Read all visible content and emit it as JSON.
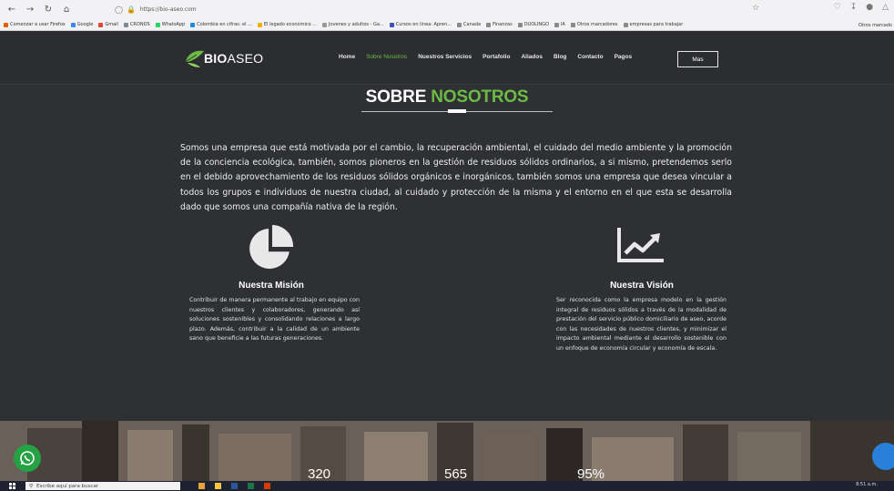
{
  "browser": {
    "url": "https://bio-aseo.com",
    "bookmarks": [
      {
        "label": "Comenzar a usar Firefox",
        "color": "#e66000"
      },
      {
        "label": "Google",
        "color": "#4285f4"
      },
      {
        "label": "Gmail",
        "color": "#ea4335"
      },
      {
        "label": "CRONOS",
        "color": "#7b8a99"
      },
      {
        "label": "WhatsApp",
        "color": "#25d366"
      },
      {
        "label": "Colombia en cifras: el ...",
        "color": "#1e88e5"
      },
      {
        "label": "El legado económico ...",
        "color": "#f2b200"
      },
      {
        "label": "Jovenes y adultos - Ga...",
        "color": "#999999"
      },
      {
        "label": "Cursos en línea: Apren...",
        "color": "#3f51b5"
      },
      {
        "label": "Canada",
        "color": "#8a8a8a"
      },
      {
        "label": "Finanzas",
        "color": "#8a8a8a"
      },
      {
        "label": "DUOLINGO",
        "color": "#8a8a8a"
      },
      {
        "label": "IA",
        "color": "#8a8a8a"
      },
      {
        "label": "Otros marcadores",
        "color": "#8a8a8a"
      },
      {
        "label": "empresas para trabajar",
        "color": "#8a8a8a"
      }
    ],
    "other_bookmarks": "Otros marcado"
  },
  "site": {
    "logo_bio": "BIO",
    "logo_aseo": "ASEO",
    "nav": [
      "Home",
      "Sobre Nosotros",
      "Nuestros Servicios",
      "Portafolio",
      "Aliados",
      "Blog",
      "Contacto",
      "Pagos"
    ],
    "nav_active": "Sobre Nosotros",
    "nav_more": "Mas",
    "accent": "#6dbb45"
  },
  "about": {
    "title_white": "SOBRE",
    "title_green": "NOSOTROS",
    "intro": "Somos una empresa que está motivada por el cambio, la recuperación ambiental, el cuidado del medio ambiente y la promoción de la conciencia ecológica, también, somos pioneros en la gestión de residuos sólidos ordinarios, a si mismo, pretendemos serlo en el debido aprovechamiento de los residuos sólidos orgánicos e inorgánicos, también somos una empresa que desea vincular a todos los grupos e individuos de nuestra ciudad, al cuidado y protección de la misma y el entorno en el que esta se desarrolla dado que somos una compañía nativa de la región.",
    "mision_title": "Nuestra Misión",
    "mision_text": "Contribuir de manera permanente al trabajo en equipo con nuestros clientes y colaboradores, generando así soluciones sostenibles y consolidando relaciones a largo plazo. Además, contribuir a la calidad de un ambiente sano que beneficie a las futuras generaciones.",
    "vision_title": "Nuestra Visión",
    "vision_text": "Ser reconocida como la empresa modelo en la gestión integral de residuos sólidos a través de la modalidad de prestación del servicio público domiciliario de aseo, acorde con las necesidades de nuestros clientes, y minimizar el impacto ambiental mediante el desarrollo sostenible con un enfoque de economía circular y economía de escala."
  },
  "stats": [
    "320",
    "565",
    "95%"
  ],
  "taskbar": {
    "search_placeholder": "Escribe aquí para buscar",
    "time": "8:51 a.m."
  }
}
